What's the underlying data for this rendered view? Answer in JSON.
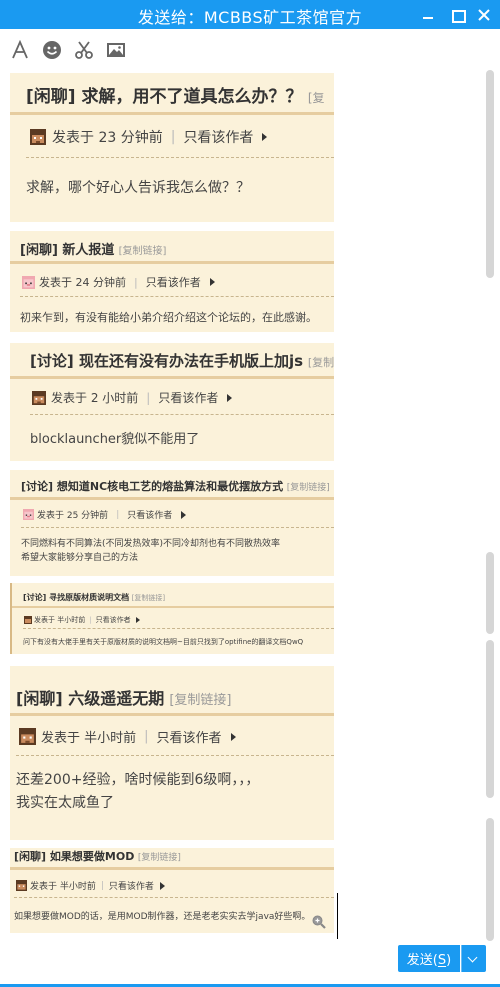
{
  "window": {
    "title": "发送给：MCBBS矿工茶馆官方"
  },
  "toolbar": {
    "icons": [
      "font-icon",
      "emoji-icon",
      "scissors-icon",
      "image-icon"
    ]
  },
  "posts": [
    {
      "category": "[闲聊]",
      "title": "求解，用不了道具怎么办？？",
      "copy_link": "[复",
      "meta_posted": "发表于 23 分钟前",
      "meta_author_only": "只看该作者",
      "body": [
        "求解，哪个好心人告诉我怎么做？？"
      ]
    },
    {
      "category": "[闲聊]",
      "title": "新人报道",
      "copy_link": "[复制链接]",
      "meta_posted": "发表于 24 分钟前",
      "meta_author_only": "只看该作者",
      "body": [
        "初来乍到，有没有能给小弟介绍介绍这个论坛的，在此感谢。"
      ]
    },
    {
      "category": "[讨论]",
      "title": "现在还有没有办法在手机版上加js",
      "copy_link": "[复制",
      "meta_posted": "发表于 2 小时前",
      "meta_author_only": "只看该作者",
      "body": [
        "blocklauncher貌似不能用了"
      ]
    },
    {
      "category": "[讨论]",
      "title": "想知道NC核电工艺的熔盐算法和最优摆放方式",
      "copy_link": "[复制链接]",
      "meta_posted": "发表于 25 分钟前",
      "meta_author_only": "只看该作者",
      "body": [
        "不同燃料有不同算法(不同发热效率)不同冷却剂也有不同散热效率",
        "希望大家能够分享自己的方法"
      ]
    },
    {
      "category": "[讨论]",
      "title": "寻找原版材质说明文档",
      "copy_link": "[复制链接]",
      "meta_posted": "发表于 半小时前",
      "meta_author_only": "只看该作者",
      "body": [
        "问下有没有大佬手里有关于原版材质的说明文档啊~目前只找到了optifine的翻译文档QwQ"
      ]
    },
    {
      "category": "[闲聊]",
      "title": "六级遥遥无期",
      "copy_link": "[复制链接]",
      "meta_posted": "发表于 半小时前",
      "meta_author_only": "只看该作者",
      "body": [
        "还差200+经验，啥时候能到6级啊，，，",
        "我实在太咸鱼了"
      ]
    },
    {
      "category": "[闲聊]",
      "title": "如果想要做MOD",
      "copy_link": "[复制链接]",
      "meta_posted": "发表于 半小时前",
      "meta_author_only": "只看该作者",
      "body": [
        "如果想要做MOD的话，是用MOD制作器，还是老老实实去学java好些啊。"
      ]
    }
  ],
  "send": {
    "label": "发送(",
    "shortcut": "S",
    "label_end": ")"
  },
  "colors": {
    "accent": "#1a9af1",
    "card_bg": "#fbf2da",
    "card_bar": "#e6cda0"
  }
}
